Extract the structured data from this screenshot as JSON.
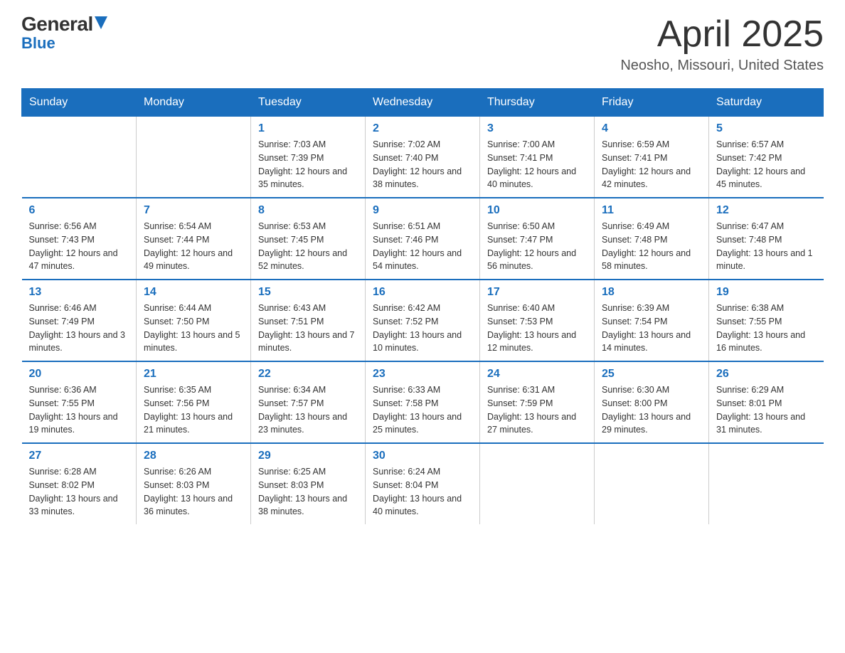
{
  "header": {
    "logo_general": "General",
    "logo_blue": "Blue",
    "title": "April 2025",
    "subtitle": "Neosho, Missouri, United States"
  },
  "days_of_week": [
    "Sunday",
    "Monday",
    "Tuesday",
    "Wednesday",
    "Thursday",
    "Friday",
    "Saturday"
  ],
  "weeks": [
    [
      {
        "day": "",
        "info": ""
      },
      {
        "day": "",
        "info": ""
      },
      {
        "day": "1",
        "info": "Sunrise: 7:03 AM\nSunset: 7:39 PM\nDaylight: 12 hours\nand 35 minutes."
      },
      {
        "day": "2",
        "info": "Sunrise: 7:02 AM\nSunset: 7:40 PM\nDaylight: 12 hours\nand 38 minutes."
      },
      {
        "day": "3",
        "info": "Sunrise: 7:00 AM\nSunset: 7:41 PM\nDaylight: 12 hours\nand 40 minutes."
      },
      {
        "day": "4",
        "info": "Sunrise: 6:59 AM\nSunset: 7:41 PM\nDaylight: 12 hours\nand 42 minutes."
      },
      {
        "day": "5",
        "info": "Sunrise: 6:57 AM\nSunset: 7:42 PM\nDaylight: 12 hours\nand 45 minutes."
      }
    ],
    [
      {
        "day": "6",
        "info": "Sunrise: 6:56 AM\nSunset: 7:43 PM\nDaylight: 12 hours\nand 47 minutes."
      },
      {
        "day": "7",
        "info": "Sunrise: 6:54 AM\nSunset: 7:44 PM\nDaylight: 12 hours\nand 49 minutes."
      },
      {
        "day": "8",
        "info": "Sunrise: 6:53 AM\nSunset: 7:45 PM\nDaylight: 12 hours\nand 52 minutes."
      },
      {
        "day": "9",
        "info": "Sunrise: 6:51 AM\nSunset: 7:46 PM\nDaylight: 12 hours\nand 54 minutes."
      },
      {
        "day": "10",
        "info": "Sunrise: 6:50 AM\nSunset: 7:47 PM\nDaylight: 12 hours\nand 56 minutes."
      },
      {
        "day": "11",
        "info": "Sunrise: 6:49 AM\nSunset: 7:48 PM\nDaylight: 12 hours\nand 58 minutes."
      },
      {
        "day": "12",
        "info": "Sunrise: 6:47 AM\nSunset: 7:48 PM\nDaylight: 13 hours\nand 1 minute."
      }
    ],
    [
      {
        "day": "13",
        "info": "Sunrise: 6:46 AM\nSunset: 7:49 PM\nDaylight: 13 hours\nand 3 minutes."
      },
      {
        "day": "14",
        "info": "Sunrise: 6:44 AM\nSunset: 7:50 PM\nDaylight: 13 hours\nand 5 minutes."
      },
      {
        "day": "15",
        "info": "Sunrise: 6:43 AM\nSunset: 7:51 PM\nDaylight: 13 hours\nand 7 minutes."
      },
      {
        "day": "16",
        "info": "Sunrise: 6:42 AM\nSunset: 7:52 PM\nDaylight: 13 hours\nand 10 minutes."
      },
      {
        "day": "17",
        "info": "Sunrise: 6:40 AM\nSunset: 7:53 PM\nDaylight: 13 hours\nand 12 minutes."
      },
      {
        "day": "18",
        "info": "Sunrise: 6:39 AM\nSunset: 7:54 PM\nDaylight: 13 hours\nand 14 minutes."
      },
      {
        "day": "19",
        "info": "Sunrise: 6:38 AM\nSunset: 7:55 PM\nDaylight: 13 hours\nand 16 minutes."
      }
    ],
    [
      {
        "day": "20",
        "info": "Sunrise: 6:36 AM\nSunset: 7:55 PM\nDaylight: 13 hours\nand 19 minutes."
      },
      {
        "day": "21",
        "info": "Sunrise: 6:35 AM\nSunset: 7:56 PM\nDaylight: 13 hours\nand 21 minutes."
      },
      {
        "day": "22",
        "info": "Sunrise: 6:34 AM\nSunset: 7:57 PM\nDaylight: 13 hours\nand 23 minutes."
      },
      {
        "day": "23",
        "info": "Sunrise: 6:33 AM\nSunset: 7:58 PM\nDaylight: 13 hours\nand 25 minutes."
      },
      {
        "day": "24",
        "info": "Sunrise: 6:31 AM\nSunset: 7:59 PM\nDaylight: 13 hours\nand 27 minutes."
      },
      {
        "day": "25",
        "info": "Sunrise: 6:30 AM\nSunset: 8:00 PM\nDaylight: 13 hours\nand 29 minutes."
      },
      {
        "day": "26",
        "info": "Sunrise: 6:29 AM\nSunset: 8:01 PM\nDaylight: 13 hours\nand 31 minutes."
      }
    ],
    [
      {
        "day": "27",
        "info": "Sunrise: 6:28 AM\nSunset: 8:02 PM\nDaylight: 13 hours\nand 33 minutes."
      },
      {
        "day": "28",
        "info": "Sunrise: 6:26 AM\nSunset: 8:03 PM\nDaylight: 13 hours\nand 36 minutes."
      },
      {
        "day": "29",
        "info": "Sunrise: 6:25 AM\nSunset: 8:03 PM\nDaylight: 13 hours\nand 38 minutes."
      },
      {
        "day": "30",
        "info": "Sunrise: 6:24 AM\nSunset: 8:04 PM\nDaylight: 13 hours\nand 40 minutes."
      },
      {
        "day": "",
        "info": ""
      },
      {
        "day": "",
        "info": ""
      },
      {
        "day": "",
        "info": ""
      }
    ]
  ]
}
